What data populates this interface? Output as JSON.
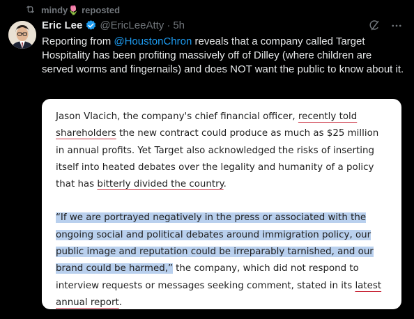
{
  "repost": {
    "user": "mindy🌷",
    "label": "reposted"
  },
  "author": {
    "name": "Eric Lee",
    "handle": "@EricLeeAtty",
    "sep": "·",
    "time": "5h"
  },
  "tweet": {
    "prefix": "Reporting from ",
    "mention": "@HoustonChron",
    "suffix": " reveals that a company called Target Hospitality has been profiting massively off of Dilley (where children are served worms and fingernails) and does NOT want the public to know about it."
  },
  "article": {
    "p1": {
      "a": "Jason Vlacich, the company's chief financial officer, ",
      "link1": "recently told shareholders",
      "b": " the new contract could produce as much as $25 million in annual profits. Yet Target also acknowledged the risks of inserting itself into heated debates over the legality and humanity of a policy that has ",
      "link2": "bitterly divided the country",
      "c": "."
    },
    "p2": {
      "quote": "“If we are portrayed negatively in the press or associated with the ongoing social and political debates around immigration policy, our public image and reputation could be irreparably tarnished, and our brand could be harmed,”",
      "rest": " the company, which did not respond to interview requests or messages seeking comment, stated in its ",
      "link": "latest annual report",
      "end": "."
    }
  },
  "colors": {
    "accent": "#1d9bf0",
    "verified": "#1d9bf0",
    "highlight": "#b9d0ee",
    "underline": "#c8283a"
  },
  "icons": [
    "repost-icon",
    "verified-icon",
    "grok-icon",
    "more-icon"
  ]
}
